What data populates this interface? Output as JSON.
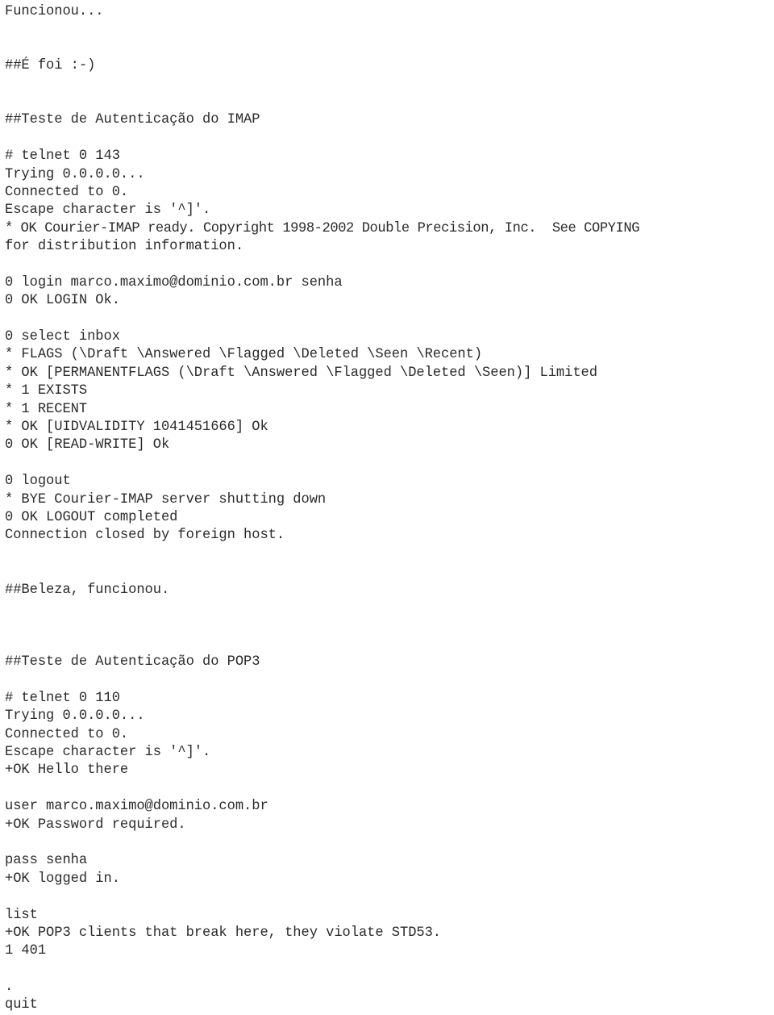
{
  "document": {
    "kind": "terminal-transcript-document",
    "language": "pt-BR",
    "text_color": "#2b2b2b",
    "background_color": "#ffffff",
    "lines": [
      {
        "id": "l01",
        "text": "Funcionou...",
        "kind": "note"
      },
      {
        "id": "l02",
        "text": "",
        "kind": "blank"
      },
      {
        "id": "l03",
        "text": "",
        "kind": "blank"
      },
      {
        "id": "l04",
        "text": "##É foi :-)",
        "kind": "note"
      },
      {
        "id": "l05",
        "text": "",
        "kind": "blank"
      },
      {
        "id": "l06",
        "text": "",
        "kind": "blank"
      },
      {
        "id": "l07",
        "text": "##Teste de Autenticação do IMAP",
        "kind": "heading"
      },
      {
        "id": "l08",
        "text": "",
        "kind": "blank"
      },
      {
        "id": "l09",
        "text": "# telnet 0 143",
        "kind": "command"
      },
      {
        "id": "l10",
        "text": "Trying 0.0.0.0...",
        "kind": "output"
      },
      {
        "id": "l11",
        "text": "Connected to 0.",
        "kind": "output"
      },
      {
        "id": "l12",
        "text": "Escape character is '^]'.",
        "kind": "output"
      },
      {
        "id": "l13",
        "text": "* OK Courier-IMAP ready. Copyright 1998-2002 Double Precision, Inc.  See COPYING",
        "kind": "output",
        "wide": true
      },
      {
        "id": "l14",
        "text": "for distribution information.",
        "kind": "output"
      },
      {
        "id": "l15",
        "text": "",
        "kind": "blank"
      },
      {
        "id": "l16",
        "text": "0 login marco.maximo@dominio.com.br senha",
        "kind": "command"
      },
      {
        "id": "l17",
        "text": "0 OK LOGIN Ok.",
        "kind": "output"
      },
      {
        "id": "l18",
        "text": "",
        "kind": "blank"
      },
      {
        "id": "l19",
        "text": "0 select inbox",
        "kind": "command"
      },
      {
        "id": "l20",
        "text": "* FLAGS (\\Draft \\Answered \\Flagged \\Deleted \\Seen \\Recent)",
        "kind": "output"
      },
      {
        "id": "l21",
        "text": "* OK [PERMANENTFLAGS (\\Draft \\Answered \\Flagged \\Deleted \\Seen)] Limited",
        "kind": "output"
      },
      {
        "id": "l22",
        "text": "* 1 EXISTS",
        "kind": "output"
      },
      {
        "id": "l23",
        "text": "* 1 RECENT",
        "kind": "output"
      },
      {
        "id": "l24",
        "text": "* OK [UIDVALIDITY 1041451666] Ok",
        "kind": "output"
      },
      {
        "id": "l25",
        "text": "0 OK [READ-WRITE] Ok",
        "kind": "output"
      },
      {
        "id": "l26",
        "text": "",
        "kind": "blank"
      },
      {
        "id": "l27",
        "text": "0 logout",
        "kind": "command"
      },
      {
        "id": "l28",
        "text": "* BYE Courier-IMAP server shutting down",
        "kind": "output"
      },
      {
        "id": "l29",
        "text": "0 OK LOGOUT completed",
        "kind": "output"
      },
      {
        "id": "l30",
        "text": "Connection closed by foreign host.",
        "kind": "output"
      },
      {
        "id": "l31",
        "text": "",
        "kind": "blank"
      },
      {
        "id": "l32",
        "text": "",
        "kind": "blank"
      },
      {
        "id": "l33",
        "text": "##Beleza, funcionou.",
        "kind": "note"
      },
      {
        "id": "l34",
        "text": "",
        "kind": "blank"
      },
      {
        "id": "l35",
        "text": "",
        "kind": "blank"
      },
      {
        "id": "l36",
        "text": "",
        "kind": "blank"
      },
      {
        "id": "l37",
        "text": "##Teste de Autenticação do POP3",
        "kind": "heading"
      },
      {
        "id": "l38",
        "text": "",
        "kind": "blank"
      },
      {
        "id": "l39",
        "text": "# telnet 0 110",
        "kind": "command"
      },
      {
        "id": "l40",
        "text": "Trying 0.0.0.0...",
        "kind": "output"
      },
      {
        "id": "l41",
        "text": "Connected to 0.",
        "kind": "output"
      },
      {
        "id": "l42",
        "text": "Escape character is '^]'.",
        "kind": "output"
      },
      {
        "id": "l43",
        "text": "+OK Hello there",
        "kind": "output"
      },
      {
        "id": "l44",
        "text": "",
        "kind": "blank"
      },
      {
        "id": "l45",
        "text": "user marco.maximo@dominio.com.br",
        "kind": "command"
      },
      {
        "id": "l46",
        "text": "+OK Password required.",
        "kind": "output"
      },
      {
        "id": "l47",
        "text": "",
        "kind": "blank"
      },
      {
        "id": "l48",
        "text": "pass senha",
        "kind": "command"
      },
      {
        "id": "l49",
        "text": "+OK logged in.",
        "kind": "output"
      },
      {
        "id": "l50",
        "text": "",
        "kind": "blank"
      },
      {
        "id": "l51",
        "text": "list",
        "kind": "command"
      },
      {
        "id": "l52",
        "text": "+OK POP3 clients that break here, they violate STD53.",
        "kind": "output"
      },
      {
        "id": "l53",
        "text": "1 401",
        "kind": "output"
      },
      {
        "id": "l54",
        "text": "",
        "kind": "blank"
      },
      {
        "id": "l55",
        "text": ".",
        "kind": "output"
      },
      {
        "id": "l56",
        "text": "quit",
        "kind": "command"
      }
    ]
  }
}
